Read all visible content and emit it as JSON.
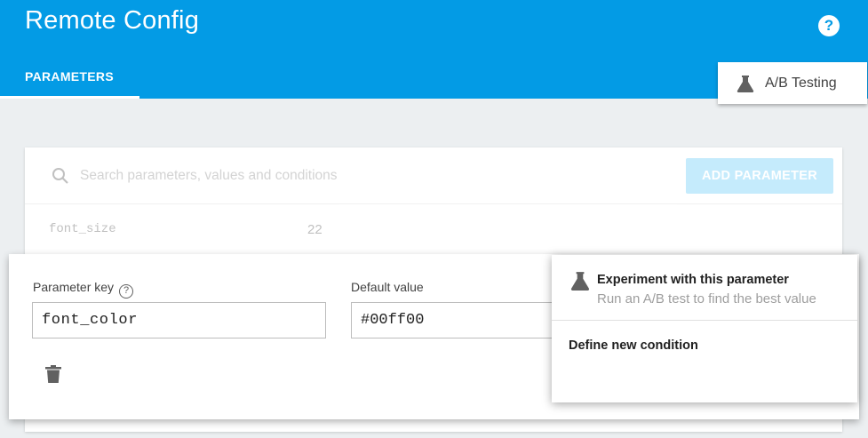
{
  "app": {
    "title": "Remote Config",
    "help_icon": "help-circle-icon"
  },
  "tabs": [
    {
      "label": "PARAMETERS",
      "active": true
    }
  ],
  "ab_testing": {
    "label": "A/B Testing",
    "icon": "flask-icon"
  },
  "search": {
    "placeholder": "Search parameters, values and conditions",
    "icon": "search-icon"
  },
  "toolbar": {
    "add_label": "ADD PARAMETER"
  },
  "parameters": [
    {
      "key": "font_size",
      "value": "22"
    }
  ],
  "editor": {
    "key_label": "Parameter key",
    "key_value": "font_color",
    "default_label": "Default value",
    "default_value": "#00ff00",
    "delete_icon": "trash-icon"
  },
  "menu": {
    "experiment_title": "Experiment with this parameter",
    "experiment_subtitle": "Run an A/B test to find the best value",
    "define_condition": "Define new condition"
  },
  "colors": {
    "appbar": "#039be5",
    "add_button": "#81d4fa",
    "background": "#eceff1"
  }
}
